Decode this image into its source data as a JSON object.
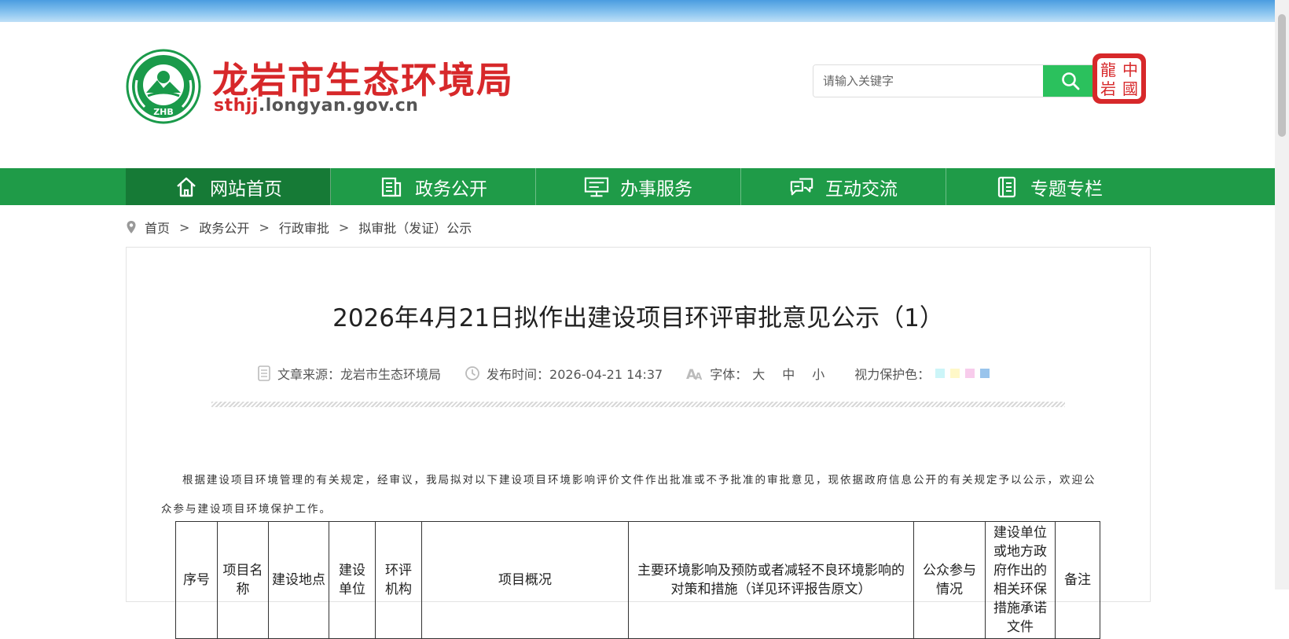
{
  "site": {
    "title": "龙岩市生态环境局",
    "domain_prefix": "sthjj",
    "domain_rest": ".longyan.gov.cn",
    "emblem_text": "ZHB",
    "seal_text": "龍岩中國"
  },
  "search": {
    "placeholder": "请输入关键字",
    "button_icon": "search-icon"
  },
  "nav": {
    "items": [
      {
        "label": "网站首页",
        "icon": "home-icon"
      },
      {
        "label": "政务公开",
        "icon": "document-icon"
      },
      {
        "label": "办事服务",
        "icon": "service-icon"
      },
      {
        "label": "互动交流",
        "icon": "chat-icon"
      },
      {
        "label": "专题专栏",
        "icon": "book-icon"
      }
    ]
  },
  "breadcrumb": {
    "icon": "location-icon",
    "items": [
      "首页",
      "政务公开",
      "行政审批",
      "拟审批（发证）公示"
    ],
    "separator": ">"
  },
  "article": {
    "title": "2026年4月21日拟作出建设项目环评审批意见公示（1）",
    "source_label": "文章来源：龙岩市生态环境局",
    "publish_label": "发布时间：2026-04-21 14:37",
    "font_label": "字体：",
    "font_sizes": [
      "大",
      "中",
      "小"
    ],
    "eye_label": "视力保护色：",
    "eye_colors": [
      "#ccf5f8",
      "#fff8c8",
      "#f8ccec",
      "#99c4ec"
    ],
    "intro": "根据建设项目环境管理的有关规定，经审议，我局拟对以下建设项目环境影响评价文件作出批准或不予批准的审批意见，现依据政府信息公开的有关规定予以公示，欢迎公众参与建设项目环境保护工作。"
  },
  "table": {
    "headers": [
      "序号",
      "项目名称",
      "建设地点",
      "建设单位",
      "环评机构",
      "项目概况",
      "主要环境影响及预防或者减轻不良环境影响的对策和措施（详见环评报告原文）",
      "公众参与情况",
      "建设单位或地方政府作出的相关环保措施承诺文件",
      "备注"
    ]
  },
  "colors": {
    "brand_red": "#d7282a",
    "nav_green": "#1f9b48",
    "nav_active": "#167a36",
    "search_green": "#2bc15d"
  }
}
